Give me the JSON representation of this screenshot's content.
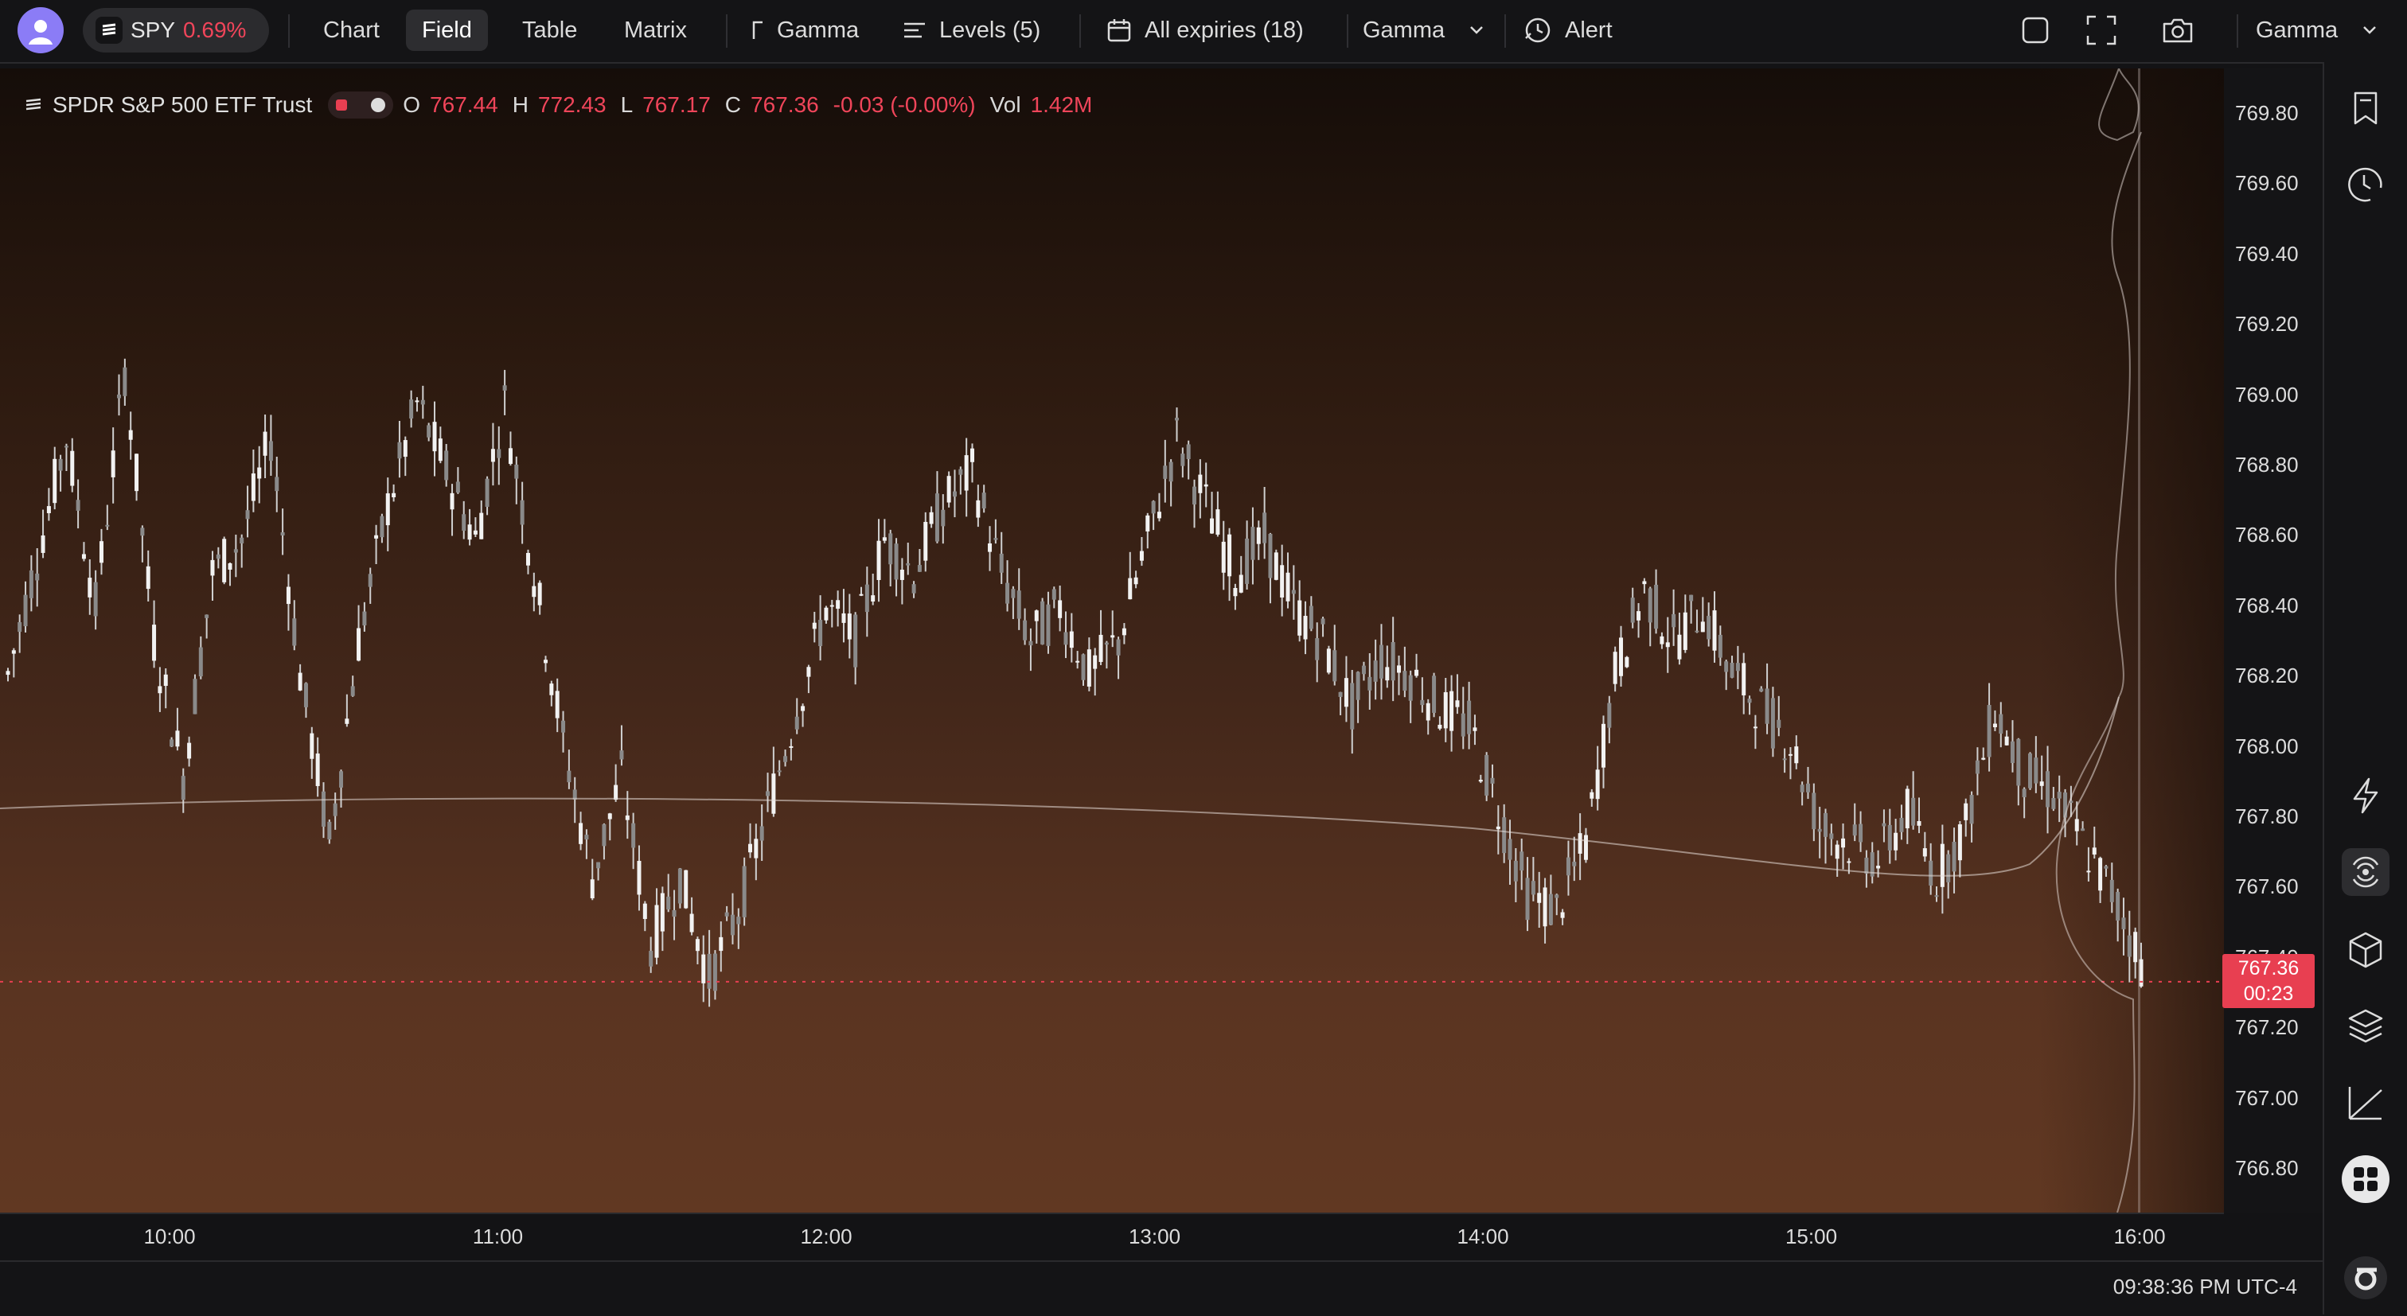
{
  "toolbar": {
    "ticker": "SPY",
    "ticker_change": "0.69%",
    "tabs": [
      {
        "label": "Chart"
      },
      {
        "label": "Field"
      },
      {
        "label": "Table"
      },
      {
        "label": "Matrix"
      }
    ],
    "active_tab": "Field",
    "gamma_button": "Gamma",
    "levels_button": "Levels (5)",
    "expiries_button": "All expiries (18)",
    "gamma_select": "Gamma",
    "alert_button": "Alert",
    "profile_select": "Gamma"
  },
  "legend": {
    "name": "SPDR S&P 500 ETF Trust",
    "o_label": "O",
    "open": "767.44",
    "h_label": "H",
    "high": "772.43",
    "l_label": "L",
    "low": "767.17",
    "c_label": "C",
    "close": "767.36",
    "change": "-0.03 (-0.00%)",
    "vol_label": "Vol",
    "volume": "1.42M"
  },
  "price_axis": [
    "769.80",
    "769.60",
    "769.40",
    "769.20",
    "769.00",
    "768.80",
    "768.60",
    "768.40",
    "768.20",
    "768.00",
    "767.80",
    "767.60",
    "767.40",
    "767.20",
    "767.00",
    "766.80"
  ],
  "current_price": {
    "price": "767.36",
    "countdown": "00:23"
  },
  "time_axis": [
    "10:00",
    "11:00",
    "12:00",
    "13:00",
    "14:00",
    "15:00",
    "16:00"
  ],
  "status": {
    "clock": "09:38:36 PM UTC-4"
  },
  "colors": {
    "accent_red": "#f0455a",
    "candle": "#d9d9d9",
    "field_dark": "#150d09",
    "field_light": "#613822",
    "price_tag": "#e83f51"
  },
  "sidebar_icons": [
    "bookmark-icon",
    "history-icon",
    "lightning-icon",
    "radar-icon",
    "cube-icon",
    "layers-icon",
    "trend-line-icon",
    "grid-icon",
    "logo-icon"
  ],
  "chart_data": {
    "type": "candlestick",
    "x_range": [
      "09:30",
      "16:00"
    ],
    "y_range": [
      766.7,
      769.9
    ],
    "series": [
      {
        "values": [
          768.2,
          768.55,
          768.9,
          768.4,
          769.1,
          768.3,
          767.9,
          768.5,
          768.6,
          768.9,
          768.2,
          767.7,
          768.3,
          768.7,
          769.0,
          768.8,
          768.6,
          769.0,
          768.5,
          768.0,
          767.6,
          767.9,
          767.4,
          767.6,
          767.3,
          767.5,
          767.8,
          768.1,
          768.4,
          768.3,
          768.6,
          768.5,
          768.7,
          768.8,
          768.5,
          768.3,
          768.4,
          768.2,
          768.3,
          768.6,
          768.9,
          768.7,
          768.5,
          768.6,
          768.4,
          768.3,
          768.1,
          768.25,
          768.2,
          768.1,
          768.05,
          767.8,
          767.55,
          767.5,
          767.7,
          768.2,
          768.45,
          768.3,
          768.4,
          768.2,
          768.1,
          768.0,
          767.75,
          767.7,
          767.65,
          767.8,
          767.6,
          767.75,
          768.1,
          767.9,
          767.85,
          767.7,
          767.55,
          767.35
        ]
      }
    ]
  }
}
